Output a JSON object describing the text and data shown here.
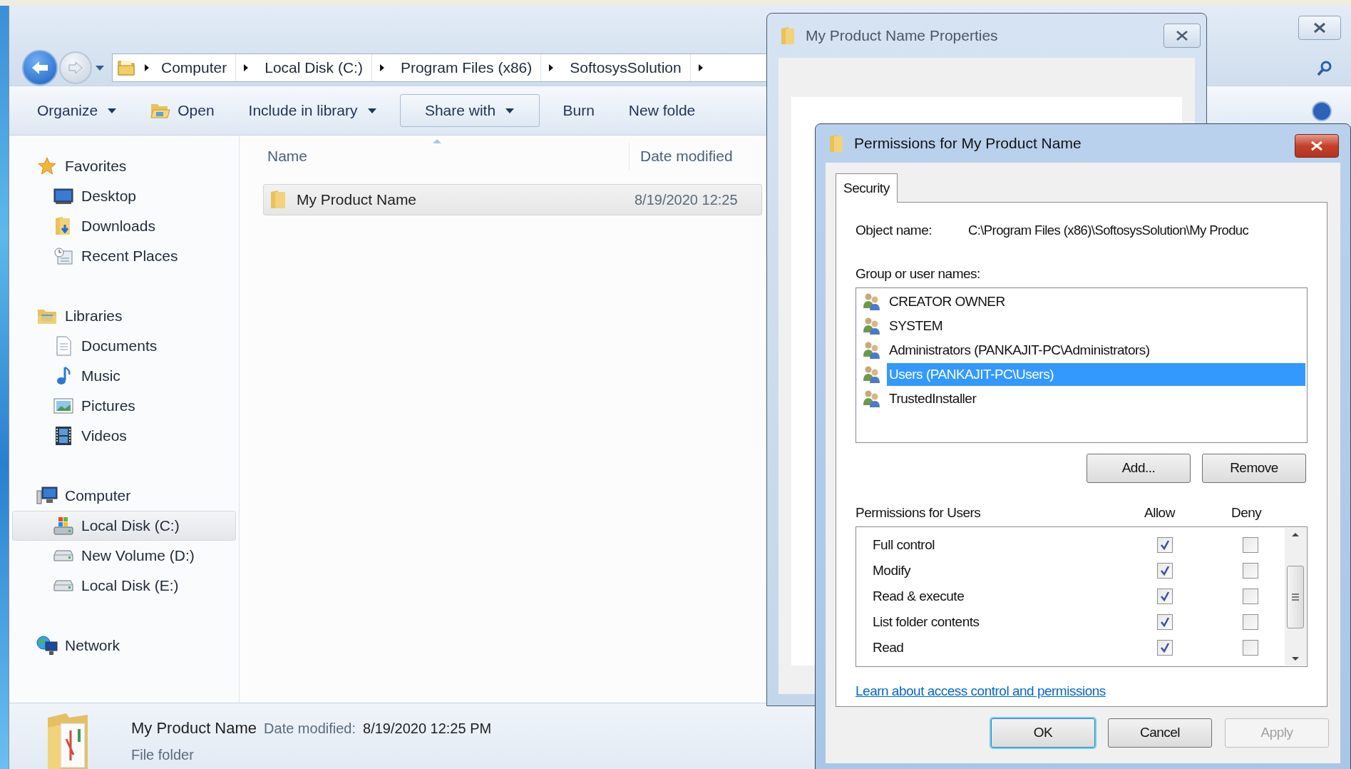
{
  "explorer": {
    "breadcrumbs": [
      "Computer",
      "Local Disk (C:)",
      "Program Files (x86)",
      "SoftosysSolution"
    ],
    "toolbar": [
      {
        "label": "Organize",
        "kind": "dropdown",
        "highlighted": false
      },
      {
        "label": "Open",
        "kind": "open",
        "highlighted": false
      },
      {
        "label": "Include in library",
        "kind": "dropdown",
        "highlighted": false
      },
      {
        "label": "Share with",
        "kind": "dropdown",
        "highlighted": true
      },
      {
        "label": "Burn",
        "kind": "plain",
        "highlighted": false
      },
      {
        "label": "New folde",
        "kind": "plain",
        "highlighted": false
      }
    ],
    "nav": [
      {
        "label": "Favorites",
        "kind": "star",
        "children": [
          {
            "label": "Desktop",
            "kind": "desktop",
            "selected": false
          },
          {
            "label": "Downloads",
            "kind": "downloads",
            "selected": false
          },
          {
            "label": "Recent Places",
            "kind": "recent",
            "selected": false
          }
        ]
      },
      {
        "label": "Libraries",
        "kind": "libraries",
        "children": [
          {
            "label": "Documents",
            "kind": "documents",
            "selected": false
          },
          {
            "label": "Music",
            "kind": "music",
            "selected": false
          },
          {
            "label": "Pictures",
            "kind": "pictures",
            "selected": false
          },
          {
            "label": "Videos",
            "kind": "videos",
            "selected": false
          }
        ]
      },
      {
        "label": "Computer",
        "kind": "computer",
        "children": [
          {
            "label": "Local Disk (C:)",
            "kind": "systemdrive",
            "selected": true
          },
          {
            "label": "New Volume (D:)",
            "kind": "drive",
            "selected": false
          },
          {
            "label": "Local Disk (E:)",
            "kind": "drive",
            "selected": false
          }
        ]
      },
      {
        "label": "Network",
        "kind": "network"
      }
    ],
    "columns": [
      "Name",
      "Date modified"
    ],
    "files": [
      {
        "name": "My Product Name",
        "date_modified": "8/19/2020 12:25",
        "selected": true
      }
    ],
    "details": {
      "name": "My Product Name",
      "date_label": "Date modified:",
      "date": "8/19/2020 12:25 PM",
      "type": "File folder"
    }
  },
  "properties_window": {
    "title": "My Product Name Properties"
  },
  "permissions_dialog": {
    "title": "Permissions for My Product Name",
    "tabs": [
      {
        "label": "Security",
        "selected": true
      }
    ],
    "object_label": "Object name:",
    "object_name": "C:\\Program Files (x86)\\SoftosysSolution\\My Produc",
    "groups_label": "Group or user names:",
    "users": [
      {
        "name": "CREATOR OWNER",
        "selected": false
      },
      {
        "name": "SYSTEM",
        "selected": false
      },
      {
        "name": "Administrators (PANKAJIT-PC\\Administrators)",
        "selected": false
      },
      {
        "name": "Users (PANKAJIT-PC\\Users)",
        "selected": true
      },
      {
        "name": "TrustedInstaller",
        "selected": false
      }
    ],
    "list_buttons": [
      "Add...",
      "Remove"
    ],
    "permissions_label": "Permissions for Users",
    "allow_label": "Allow",
    "deny_label": "Deny",
    "permissions": [
      {
        "name": "Full control",
        "allow": true,
        "deny": false
      },
      {
        "name": "Modify",
        "allow": true,
        "deny": false
      },
      {
        "name": "Read & execute",
        "allow": true,
        "deny": false
      },
      {
        "name": "List folder contents",
        "allow": true,
        "deny": false
      },
      {
        "name": "Read",
        "allow": true,
        "deny": false
      }
    ],
    "link": "Learn about access control and permissions",
    "footer_buttons": [
      {
        "label": "OK",
        "default": true,
        "disabled": false
      },
      {
        "label": "Cancel",
        "default": false,
        "disabled": false
      },
      {
        "label": "Apply",
        "default": false,
        "disabled": true
      }
    ]
  }
}
